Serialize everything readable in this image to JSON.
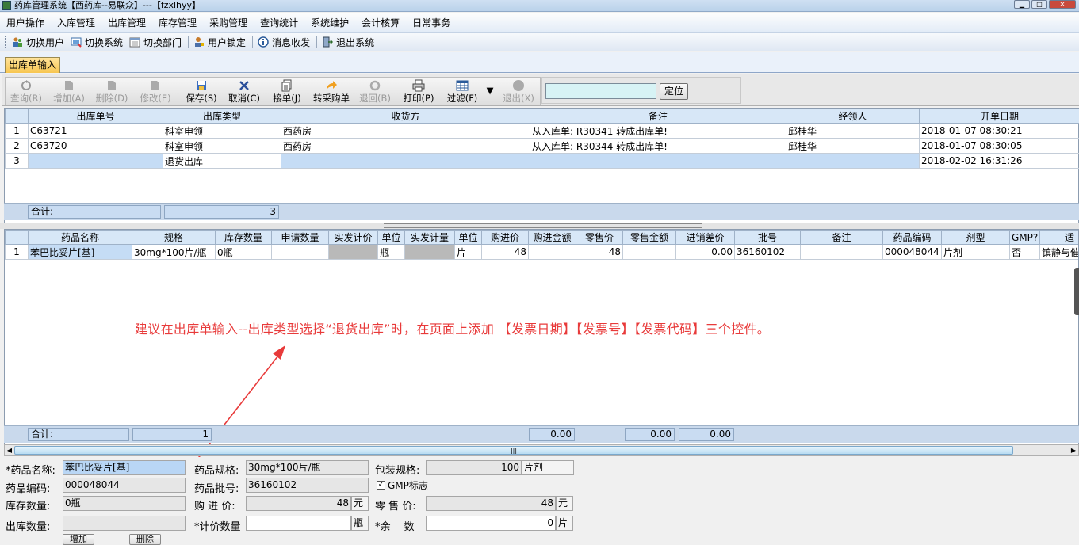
{
  "window": {
    "title": "药库管理系统【西药库--易联众】---【fzxlhyy】"
  },
  "menu": [
    "用户操作",
    "入库管理",
    "出库管理",
    "库存管理",
    "采购管理",
    "查询统计",
    "系统维护",
    "会计核算",
    "日常事务"
  ],
  "toolbar": {
    "switch_user": "切换用户",
    "switch_system": "切换系统",
    "switch_dept": "切换部门",
    "user_lock": "用户锁定",
    "messages": "消息收发",
    "exit_system": "退出系统"
  },
  "tab": {
    "label": "出库单输入"
  },
  "actions": {
    "query": "查询(R)",
    "add": "增加(A)",
    "delete": "删除(D)",
    "edit": "修改(E)",
    "save": "保存(S)",
    "cancel": "取消(C)",
    "receive": "接单(J)",
    "to_purchase": "转采购单",
    "return": "退回(B)",
    "print": "打印(P)",
    "filter": "过滤(F)",
    "exit": "退出(X)",
    "locate": "定位"
  },
  "locate_input": "",
  "orders": {
    "columns": [
      "出库单号",
      "出库类型",
      "收货方",
      "备注",
      "经领人",
      "开单日期"
    ],
    "rows": [
      {
        "n": "1",
        "no": "C63721",
        "type": "科室申领",
        "receiver": "西药房",
        "note": "从入库单: R30341 转成出库单!",
        "person": "邱桂华",
        "date": "2018-01-07 08:30:21"
      },
      {
        "n": "2",
        "no": "C63720",
        "type": "科室申领",
        "receiver": "西药房",
        "note": "从入库单: R30344 转成出库单!",
        "person": "邱桂华",
        "date": "2018-01-07 08:30:05"
      },
      {
        "n": "3",
        "no": "",
        "type": "退货出库",
        "receiver": "",
        "note": "",
        "person": "",
        "date": "2018-02-02 16:31:26"
      }
    ],
    "sum_label": "合计:",
    "sum_count": "3"
  },
  "items": {
    "columns": [
      "药品名称",
      "规格",
      "库存数量",
      "申请数量",
      "实发计价",
      "单位",
      "实发计量",
      "单位",
      "购进价",
      "购进金额",
      "零售价",
      "零售金额",
      "进销差价",
      "批号",
      "备注",
      "药品编码",
      "剂型",
      "GMP?",
      "适"
    ],
    "rows": [
      {
        "n": "1",
        "name": "苯巴比妥片[基]",
        "spec": "30mg*100片/瓶",
        "stock": "0瓶",
        "apply": "",
        "qty_price": "",
        "unit1": "瓶",
        "qty_meas": "",
        "unit2": "片",
        "buy_price": "48",
        "buy_amt": "",
        "retail": "48",
        "retail_amt": "",
        "diff": "0.00",
        "batch": "36160102",
        "note": "",
        "code": "000048044",
        "form": "片剂",
        "gmp": "否",
        "indication": "镇静与催"
      }
    ],
    "sum_label": "合计:",
    "sum_count": "1",
    "sum_buy": "0.00",
    "sum_retail": "0.00",
    "sum_diff": "0.00"
  },
  "annotation": "建议在出库单输入--出库类型选择“退货出库”时，在页面上添加 【发票日期】【发票号】【发票代码】三个控件。",
  "detail": {
    "drug_name_label": "*药品名称:",
    "drug_name": "苯巴比妥片[基]",
    "drug_spec_label": "药品规格:",
    "drug_spec": "30mg*100片/瓶",
    "pack_spec_label": "包装规格:",
    "pack_spec": "100",
    "pack_unit": "片剂",
    "drug_code_label": "药品编码:",
    "drug_code": "000048044",
    "batch_label": "药品批号:",
    "batch": "36160102",
    "gmp_label": "GMP标志",
    "gmp_checked": "✓",
    "stock_label": "库存数量:",
    "stock": "0瓶",
    "buy_price_label": "购 进 价:",
    "buy_price": "48",
    "buy_unit": "元",
    "retail_label": "零 售 价:",
    "retail": "48",
    "retail_unit": "元",
    "out_qty_label": "出库数量:",
    "out_qty": "",
    "price_qty_label": "*计价数量",
    "price_qty": "",
    "price_qty_unit": "瓶",
    "remain_label": "*余　 数",
    "remain": "0",
    "remain_unit": "片",
    "add_button": "增加",
    "delete_button": "删除"
  },
  "colors": {
    "accent_red": "#e83a3a",
    "header_blue": "#d7e7f7",
    "cell_blue": "#c5dcf5",
    "tab_yellow": "#f7c650"
  }
}
